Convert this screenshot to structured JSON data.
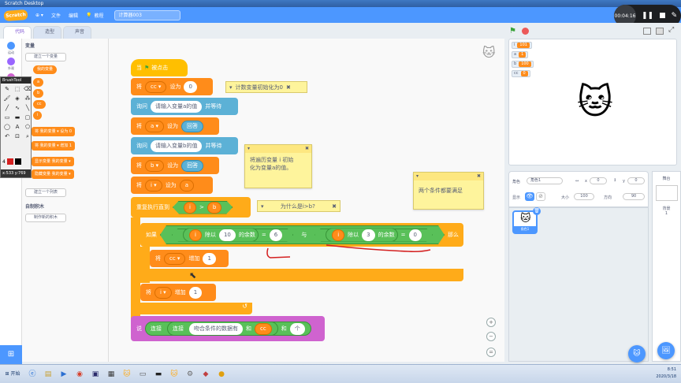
{
  "window": {
    "title": "Scratch Desktop"
  },
  "menu": {
    "logo": "Scratch",
    "globe": "⊕ ▾",
    "file": "文件",
    "edit": "编辑",
    "tutorials": "教程",
    "project_name": "计算器003"
  },
  "recorder": {
    "time": "00:04:16",
    "pause": "❚❚",
    "stop": "■",
    "pen": "✎"
  },
  "tabs": {
    "code": "代码",
    "costumes": "造型",
    "sounds": "声音"
  },
  "categories": [
    {
      "label": "运动",
      "color": "#4c97ff"
    },
    {
      "label": "外观",
      "color": "#9966ff"
    },
    {
      "label": "声音",
      "color": "#cf63cf"
    }
  ],
  "palette": {
    "section_variables": "变量",
    "make_variable": "建立一个变量",
    "my_variable": "我的变量",
    "var_a": "a",
    "var_b": "b",
    "var_cc": "cc",
    "var_i": "i",
    "set_block": "将 我的变量 ▾ 设为 0",
    "change_block": "将 我的变量 ▾ 增加 1",
    "show_var": "显示变量 我的变量 ▾",
    "hide_var": "隐藏变量 我的变量 ▾",
    "make_list": "建立一个列表",
    "section_myblocks": "自制积木",
    "make_block": "制作新的积木",
    "list_hint": "一个列表"
  },
  "brushtool": {
    "title": "BrushTool",
    "size": "4",
    "coords": "x:533  y:769"
  },
  "script": {
    "when_flag": "当",
    "when_flag_tail": "被点击",
    "set1": {
      "pre": "将",
      "var": "cc ▾",
      "mid": "设为",
      "val": "0"
    },
    "ask1": {
      "pre": "询问",
      "val": "请输入变量a的值",
      "post": "并等待"
    },
    "set2": {
      "pre": "将",
      "var": "a ▾",
      "mid": "设为",
      "val": "回答"
    },
    "ask2": {
      "pre": "询问",
      "val": "请输入变量b的值",
      "post": "并等待"
    },
    "set3": {
      "pre": "将",
      "var": "b ▾",
      "mid": "设为",
      "val": "回答"
    },
    "set4": {
      "pre": "将",
      "var": "i ▾",
      "mid": "设为",
      "val": "a"
    },
    "repeat": {
      "label": "重复执行直到",
      "left": "i",
      "op": ">",
      "right": "b"
    },
    "if": {
      "label": "如果",
      "tail": "那么",
      "c1_var": "i",
      "c1_mod": "除以",
      "c1_num": "10",
      "c1_tail": "的余数",
      "c1_eq": "=",
      "c1_val": "6",
      "and": "与",
      "c2_var": "i",
      "c2_mod": "除以",
      "c2_num": "3",
      "c2_tail": "的余数",
      "c2_eq": "=",
      "c2_val": "0"
    },
    "change_cc": {
      "pre": "将",
      "var": "cc ▾",
      "mid": "增加",
      "val": "1"
    },
    "change_i": {
      "pre": "将",
      "var": "i ▾",
      "mid": "增加",
      "val": "1"
    },
    "loop_arrow": "↺",
    "say": {
      "label": "说",
      "join1": "连接",
      "join2": "连接",
      "text": "吻合条件的数据有",
      "and1": "和",
      "var": "cc",
      "and2": "和",
      "unit": "个"
    }
  },
  "comments": {
    "c1": "计数变量初始化为0",
    "c2_line1": "将遍历变量 i 初始",
    "c2_line2": "化为变量a的值。",
    "c3": "为什么是i>b?",
    "c4": "两个条件都要满足",
    "close": "✖",
    "collapse": "▾"
  },
  "zoom": {
    "in": "+",
    "out": "−",
    "reset": "="
  },
  "stage": {
    "monitors": [
      {
        "name": "i",
        "value": "101"
      },
      {
        "name": "a",
        "value": "1"
      },
      {
        "name": "b",
        "value": "100"
      },
      {
        "name": "cc",
        "value": "0"
      }
    ]
  },
  "sprite_info": {
    "label_sprite": "角色",
    "name": "角色1",
    "x_label": "x",
    "x_val": "0",
    "y_label": "y",
    "y_val": "0",
    "label_show": "显示",
    "label_size": "大小",
    "size_val": "100",
    "label_direction": "方向",
    "direction_val": "90",
    "tile_label": "角色1"
  },
  "stage_pane": {
    "label": "舞台",
    "backdrops_label": "背景",
    "backdrops_count": "1"
  },
  "taskbar": {
    "start": "开始",
    "time": "8:51",
    "date": "2020/3/18"
  },
  "colors": {
    "scratch_blue": "#4c97ff",
    "variables": "#ff8c1a",
    "control": "#ffab19",
    "events": "#ffbf00",
    "sensing": "#5cb1d6",
    "looks": "#cf63cf",
    "operators": "#59c059",
    "annotation_red": "#d42020"
  }
}
